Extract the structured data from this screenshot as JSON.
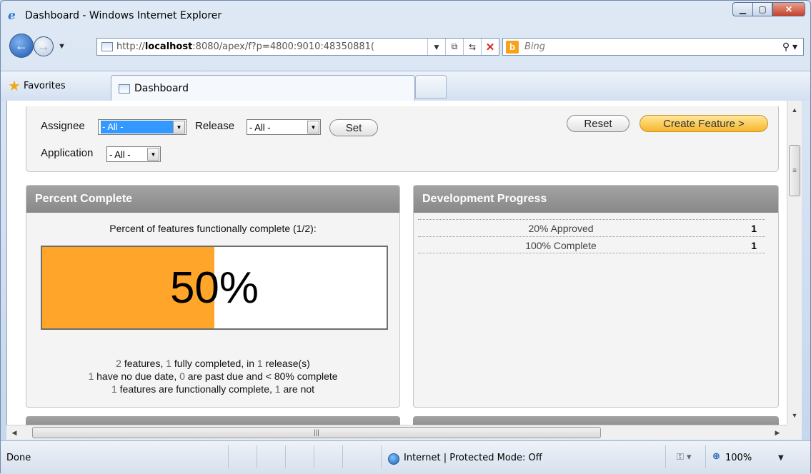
{
  "window": {
    "title": "Dashboard - Windows Internet Explorer"
  },
  "toolbar": {
    "url_prefix": "http://",
    "url_host": "localhost",
    "url_rest": ":8080/apex/f?p=4800:9010:48350881(",
    "search_placeholder": "Bing"
  },
  "favorites": {
    "label": "Favorites",
    "tab_label": "Dashboard"
  },
  "filters": {
    "assignee_label": "Assignee",
    "assignee_value": "- All -",
    "release_label": "Release",
    "release_value": "- All -",
    "set_label": "Set",
    "application_label": "Application",
    "application_value": "- All -",
    "reset_label": "Reset",
    "create_label": "Create Feature >"
  },
  "percent_complete": {
    "title": "Percent Complete",
    "caption": "Percent of features functionally complete (1/2):",
    "percent_text": "50%",
    "percent_value": 0.5,
    "fill_color": "#ffa52a",
    "line1": {
      "n1": "2",
      "t1": " features, ",
      "n2": "1",
      "t2": " fully completed, in ",
      "n3": "1",
      "t3": " release(s)"
    },
    "line2": {
      "n1": "1",
      "t1": " have no due date, ",
      "n2": "0",
      "t2": " are past due and < 80% complete"
    },
    "line3": {
      "n1": "1",
      "t1": " features are functionally complete, ",
      "n2": "1",
      "t2": " are not"
    }
  },
  "development_progress": {
    "title": "Development Progress",
    "rows": [
      {
        "label": "20% Approved",
        "value": "1"
      },
      {
        "label": "100% Complete",
        "value": "1"
      }
    ]
  },
  "statusbar": {
    "status": "Done",
    "zone": "Internet | Protected Mode: Off",
    "zoom": "100%"
  }
}
